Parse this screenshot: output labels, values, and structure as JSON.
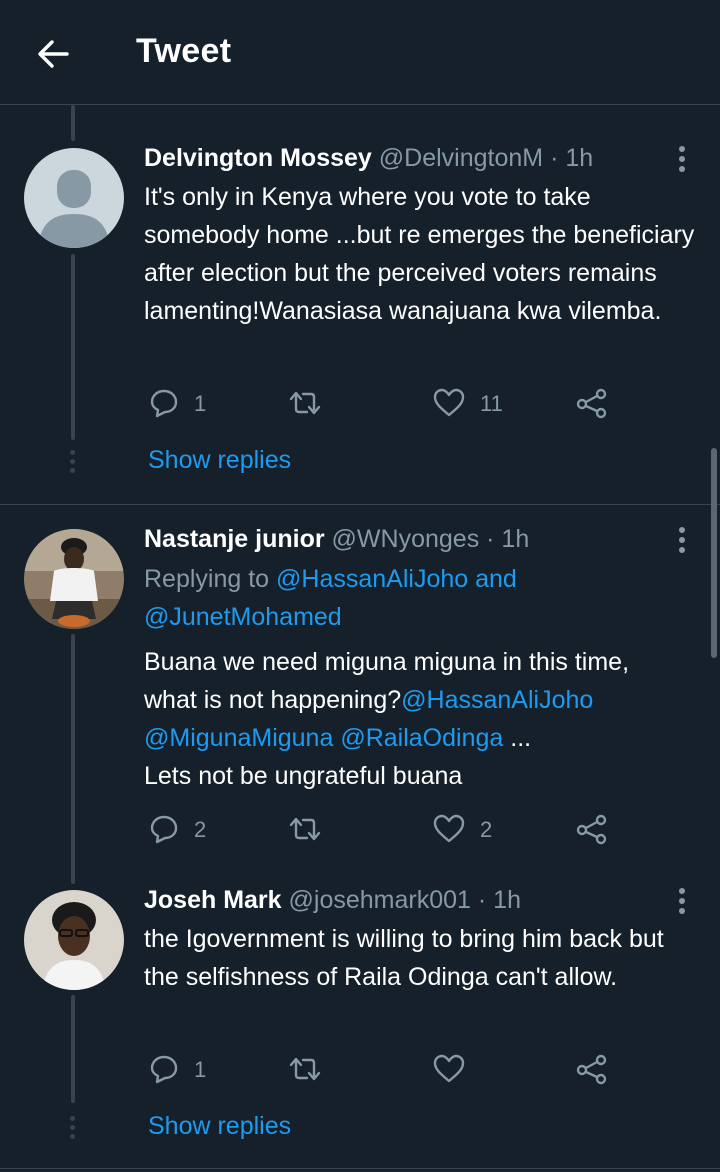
{
  "header": {
    "title": "Tweet"
  },
  "tweets": [
    {
      "name": "Delvington Mossey",
      "handle": "@DelvingtonM",
      "time": "· 1h",
      "text": "It's only in Kenya where you vote to take somebody home ...but re emerges the beneficiary after election but the perceived voters remains lamenting!Wanasiasa wanajuana kwa vilemba.",
      "replies": "1",
      "retweets": "",
      "likes": "11",
      "show_replies": "Show replies"
    },
    {
      "name": "Nastanje junior",
      "handle": "@WNyonges",
      "time": "· 1h",
      "replying_prefix": "Replying to ",
      "replying_to_1": "@HassanAliJoho and",
      "replying_to_2": "@JunetMohamed",
      "text_line1": "Buana we need miguna miguna in this time,",
      "text_line2_plain": "what is not happening?",
      "mention_1": "@HassanAliJoho",
      "mention_2": "@MigunaMiguna",
      "mention_3": "@RailaOdinga",
      "ellipsis": " ...",
      "text_line4": "Lets not be ungrateful buana",
      "replies": "2",
      "retweets": "",
      "likes": "2"
    },
    {
      "name": "Joseh Mark",
      "handle": "@josehmark001",
      "time": "· 1h",
      "text": "the Igovernment is willing to bring him back but the selfishness of Raila Odinga can't allow.",
      "replies": "1",
      "retweets": "",
      "likes": "",
      "show_replies": "Show replies"
    }
  ],
  "icons": {
    "back": "arrow-left-icon",
    "reply": "reply-icon",
    "retweet": "retweet-icon",
    "like": "heart-icon",
    "share": "share-icon",
    "more": "more-vertical-icon"
  },
  "colors": {
    "background": "#15202b",
    "accent": "#1d9bf0",
    "muted": "#8899a6",
    "border": "#38444d"
  }
}
